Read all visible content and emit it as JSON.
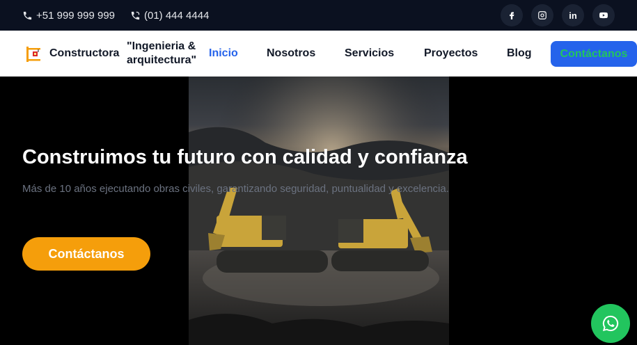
{
  "topbar": {
    "phone_mobile": "+51 999 999 999",
    "phone_landline": "(01) 444 4444",
    "social": [
      {
        "icon": "facebook-icon",
        "label": "f"
      },
      {
        "icon": "instagram-icon",
        "label": ""
      },
      {
        "icon": "linkedin-icon",
        "label": "in"
      },
      {
        "icon": "youtube-icon",
        "label": ""
      }
    ]
  },
  "nav": {
    "brand": "Constructora",
    "brand_tagline": "\"Ingenieria & arquitectura\"",
    "links": [
      "Inicio",
      "Nosotros",
      "Servicios",
      "Proyectos",
      "Blog"
    ],
    "active": "Inicio",
    "cta": "Contáctanos"
  },
  "hero": {
    "title": "Construimos tu futuro con calidad y confianza",
    "subtitle": "Más de 10 años ejecutando obras civiles, garantizando seguridad, puntualidad y excelencia.",
    "cta": "Contáctanos"
  },
  "colors": {
    "topbar_bg": "#0b1120",
    "accent_blue": "#2563eb",
    "cta_orange": "#f59e0b",
    "whatsapp_green": "#22c55e"
  }
}
